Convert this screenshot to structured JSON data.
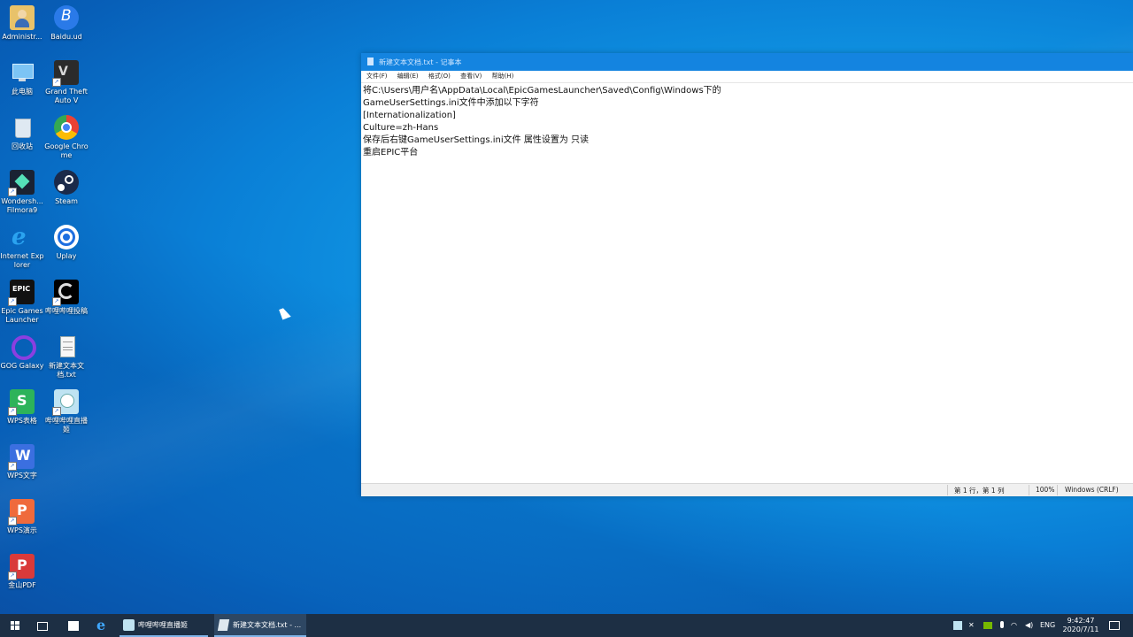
{
  "desktop": {
    "icons": [
      {
        "label": "Administr..."
      },
      {
        "label": "Baidu.ud"
      },
      {
        "label": "此电脑"
      },
      {
        "label": "Grand Theft Auto V"
      },
      {
        "label": "回收站"
      },
      {
        "label": "Google Chrome"
      },
      {
        "label": "Wondersh... Filmora9"
      },
      {
        "label": "Steam"
      },
      {
        "label": "Internet Explorer"
      },
      {
        "label": "Uplay"
      },
      {
        "label": "Epic Games Launcher"
      },
      {
        "label": "哔哩哔哩投稿"
      },
      {
        "label": "GOG Galaxy"
      },
      {
        "label": "新建文本文档.txt"
      },
      {
        "label": "WPS表格"
      },
      {
        "label": "哔哩哔哩直播姬"
      },
      {
        "label": "WPS文字"
      },
      {
        "label": "WPS演示"
      },
      {
        "label": "金山PDF"
      }
    ]
  },
  "notepad": {
    "title": "新建文本文档.txt - 记事本",
    "menu": [
      "文件(F)",
      "编辑(E)",
      "格式(O)",
      "查看(V)",
      "帮助(H)"
    ],
    "content": "将C:\\Users\\用户名\\AppData\\Local\\EpicGamesLauncher\\Saved\\Config\\Windows下的\nGameUserSettings.ini文件中添加以下字符\n[Internationalization]\nCulture=zh-Hans\n保存后右键GameUserSettings.ini文件 属性设置为 只读\n重启EPIC平台",
    "status": {
      "position": "第 1 行，第 1 列",
      "zoom": "100%",
      "encoding": "Windows (CRLF)"
    }
  },
  "taskbar": {
    "apps": [
      {
        "label": "哔哩哔哩直播姬"
      },
      {
        "label": "新建文本文档.txt - ..."
      }
    ],
    "tray": {
      "lang": "ENG",
      "time": "9:42:47",
      "date": "2020/7/11"
    }
  }
}
